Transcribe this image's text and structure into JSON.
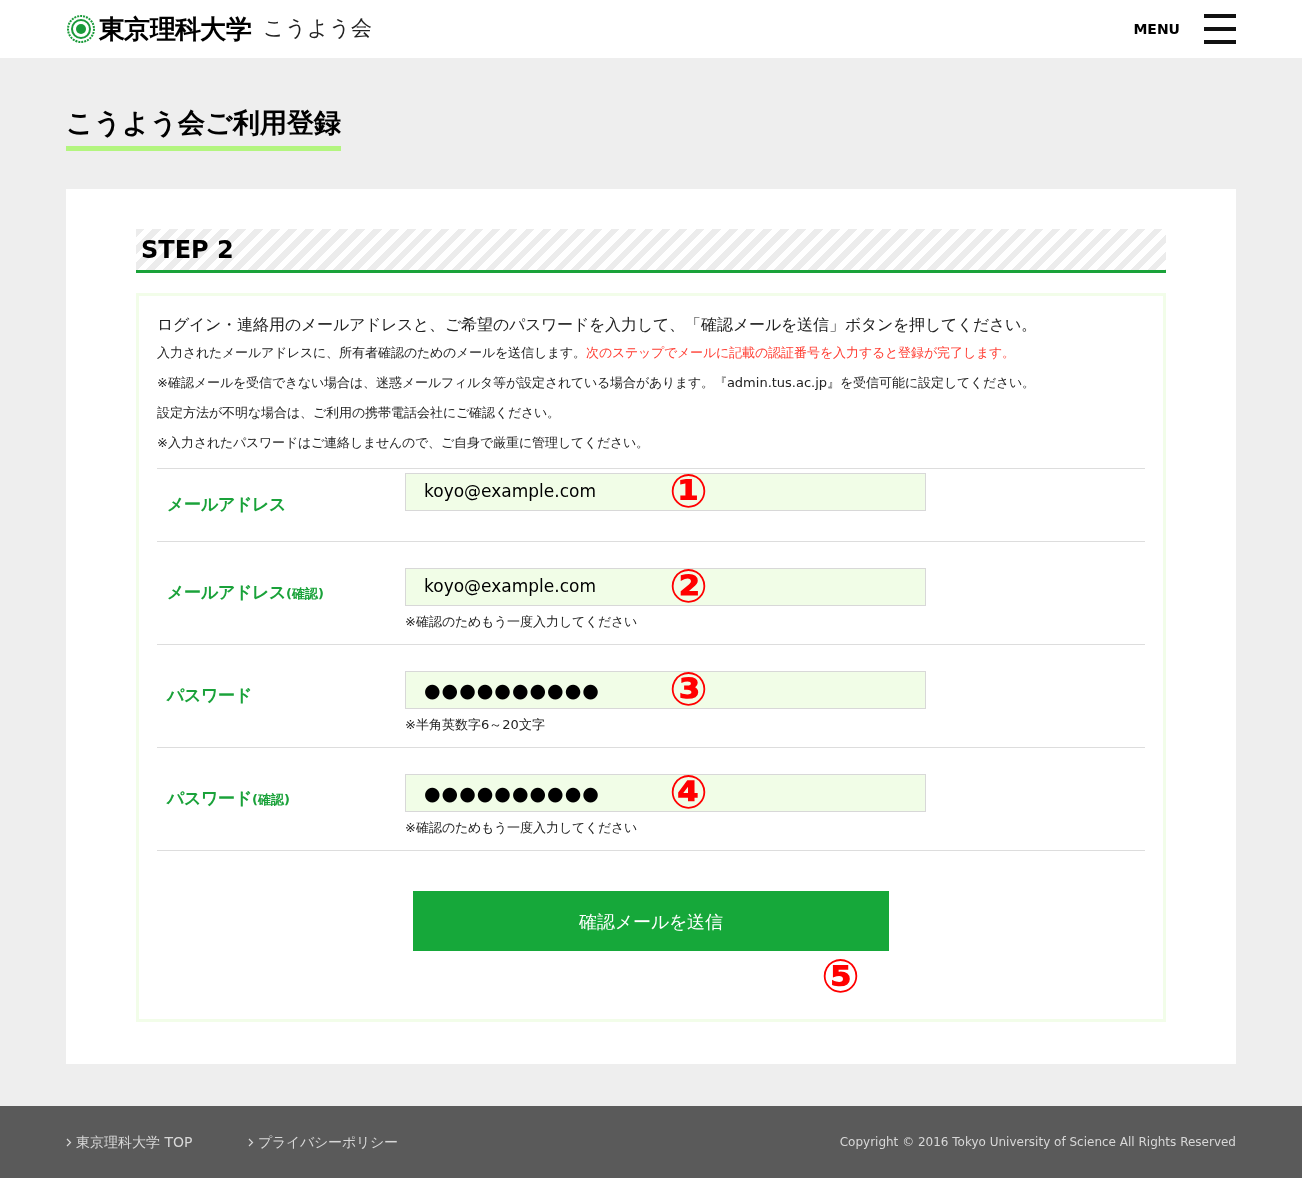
{
  "header": {
    "logo_text": "東京理科大学",
    "logo_sub": "こうよう会",
    "menu_label": "MENU"
  },
  "page_title": "こうよう会ご利用登録",
  "step_title": "STEP 2",
  "intro": {
    "lead": "ログイン・連絡用のメールアドレスと、ご希望のパスワードを入力して、「確認メールを送信」ボタンを押してください。",
    "notes": [
      {
        "text": "入力されたメールアドレスに、所有者確認のためのメールを送信します。",
        "highlight": "次のステップでメールに記載の認証番号を入力すると登録が完了します。"
      },
      {
        "text": "※確認メールを受信できない場合は、迷惑メールフィルタ等が設定されている場合があります。『admin.tus.ac.jp』を受信可能に設定してください。"
      },
      {
        "text": "設定方法が不明な場合は、ご利用の携帯電話会社にご確認ください。"
      },
      {
        "text": "※入力されたパスワードはご連絡しませんので、ご自身で厳重に管理してください。"
      }
    ]
  },
  "fields": [
    {
      "label": "メールアドレス",
      "value": "koyo@example.com",
      "kind": "email",
      "marker": "①"
    },
    {
      "label": "メールアドレス",
      "label_suffix": "(確認)",
      "value": "koyo@example.com",
      "kind": "email",
      "hint": "※確認のためもう一度入力してください",
      "marker": "②"
    },
    {
      "label": "パスワード",
      "value": "●●●●●●●●●●",
      "kind": "password",
      "hint": "※半角英数字6～20文字",
      "marker": "③"
    },
    {
      "label": "パスワード",
      "label_suffix": "(確認)",
      "value": "●●●●●●●●●●",
      "kind": "password",
      "hint": "※確認のためもう一度入力してください",
      "marker": "④"
    }
  ],
  "submit": {
    "label": "確認メールを送信",
    "marker": "⑤"
  },
  "footer": {
    "links": [
      "東京理科大学 TOP",
      "プライバシーポリシー"
    ],
    "copyright": "Copyright © 2016 Tokyo University of Science All Rights Reserved"
  }
}
